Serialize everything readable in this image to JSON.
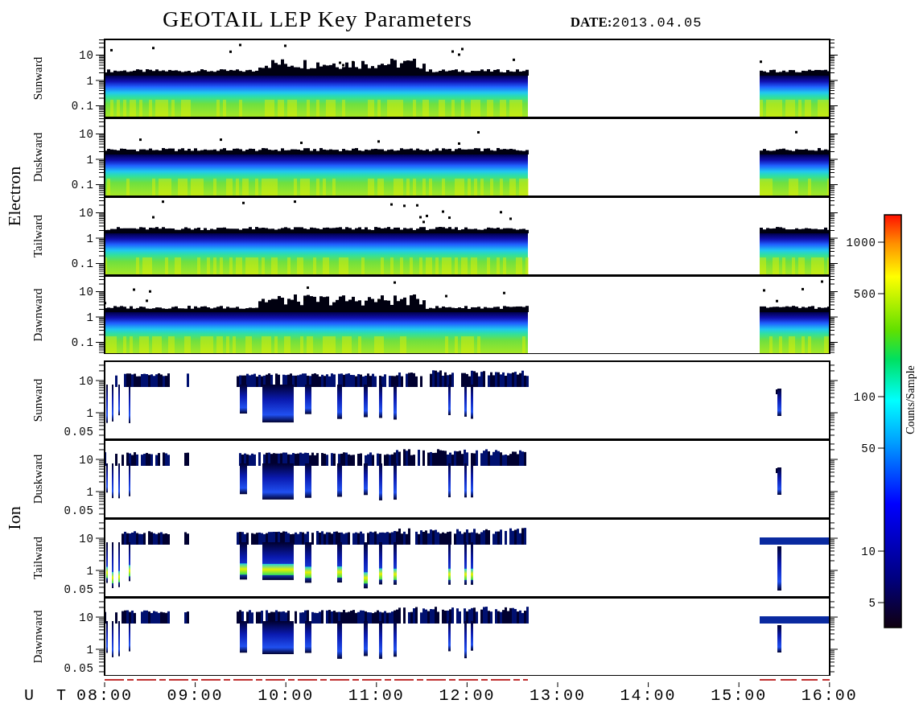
{
  "title": "GEOTAIL LEP Key Parameters",
  "date": {
    "label": "DATE:",
    "value": "2013.04.05"
  },
  "groups": [
    {
      "name": "Electron",
      "kind": "electron",
      "panels": [
        {
          "direction": "Sunward",
          "y_ticks": [
            "10",
            "1",
            "0.1"
          ]
        },
        {
          "direction": "Duskward",
          "y_ticks": [
            "10",
            "1",
            "0.1"
          ]
        },
        {
          "direction": "Tailward",
          "y_ticks": [
            "10",
            "1",
            "0.1"
          ]
        },
        {
          "direction": "Dawnward",
          "y_ticks": [
            "10",
            "1",
            "0.1"
          ]
        }
      ]
    },
    {
      "name": "Ion",
      "kind": "ion",
      "panels": [
        {
          "direction": "Sunward",
          "y_ticks": [
            "10",
            "1",
            "0.05"
          ]
        },
        {
          "direction": "Duskward",
          "y_ticks": [
            "10",
            "1",
            "0.05"
          ]
        },
        {
          "direction": "Tailward",
          "y_ticks": [
            "10",
            "1",
            "0.05"
          ]
        },
        {
          "direction": "Dawnward",
          "y_ticks": [
            "10",
            "1",
            "0.05"
          ]
        }
      ]
    }
  ],
  "x_axis": {
    "label": "U T",
    "ticks": [
      "08:00",
      "09:00",
      "10:00",
      "11:00",
      "12:00",
      "13:00",
      "14:00",
      "15:00",
      "16:00"
    ]
  },
  "colorbar": {
    "title": "Counts/Sample",
    "ticks": [
      "1000",
      "500",
      "100",
      "50",
      "10",
      "5"
    ]
  }
}
